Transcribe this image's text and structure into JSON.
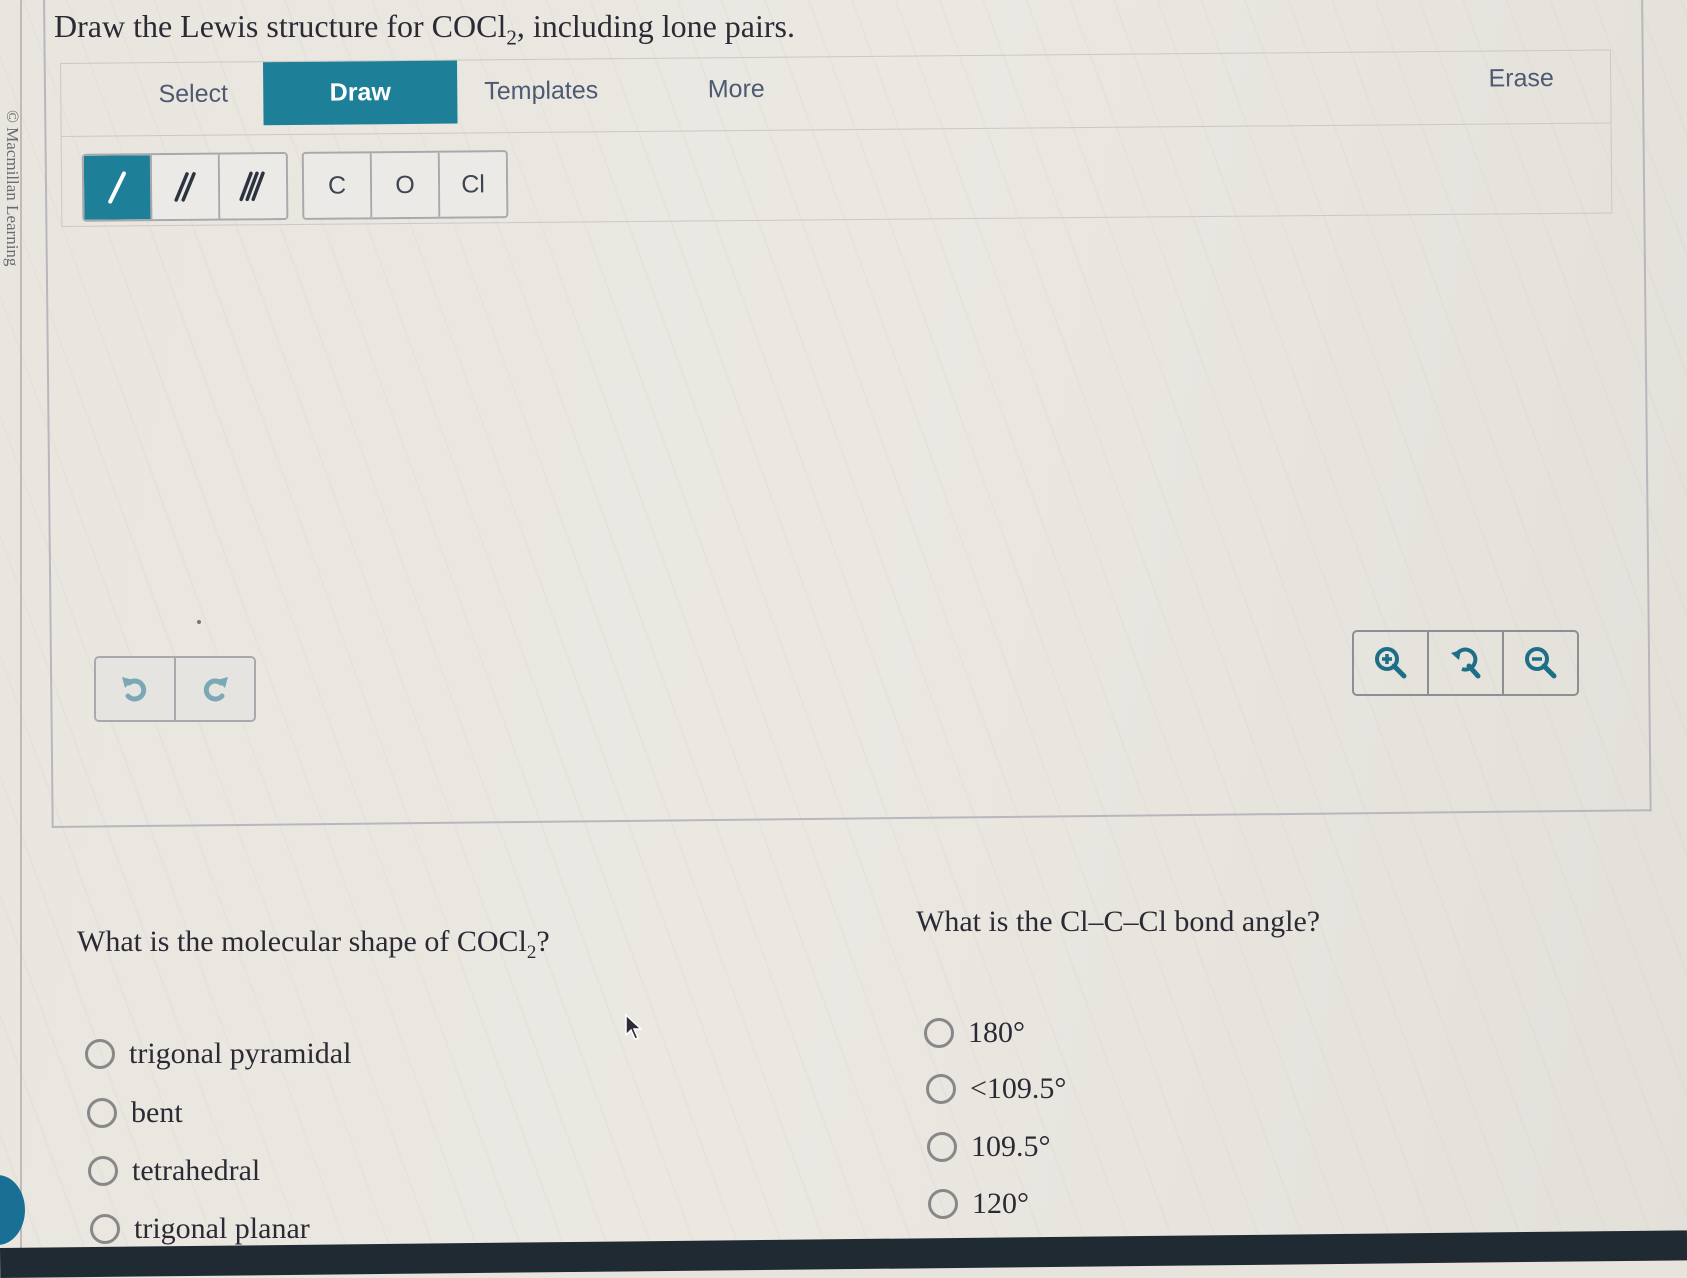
{
  "question_title": {
    "prefix": "Draw the Lewis structure for COCl",
    "subscript": "2",
    "suffix": ", including lone pairs."
  },
  "copyright": "© Macmillan Learning",
  "toolbar": {
    "tabs": [
      {
        "label": "Select",
        "active": false
      },
      {
        "label": "Draw",
        "active": true
      },
      {
        "label": "Templates",
        "active": false
      },
      {
        "label": "More",
        "active": false
      }
    ],
    "erase_label": "Erase",
    "bond_tools": [
      {
        "name": "single-bond",
        "glyph": "/",
        "active": true
      },
      {
        "name": "double-bond",
        "glyph": "//",
        "active": false
      },
      {
        "name": "triple-bond",
        "glyph": "///",
        "active": false
      }
    ],
    "atom_tools": [
      {
        "label": "C"
      },
      {
        "label": "O"
      },
      {
        "label": "Cl"
      }
    ]
  },
  "history_controls": [
    {
      "name": "undo",
      "icon": "undo-icon"
    },
    {
      "name": "redo",
      "icon": "redo-icon"
    }
  ],
  "zoom_controls": [
    {
      "name": "zoom-in",
      "icon": "zoom-in-icon"
    },
    {
      "name": "reset-zoom",
      "icon": "zoom-reset-icon"
    },
    {
      "name": "zoom-out",
      "icon": "zoom-out-icon"
    }
  ],
  "shape_question": {
    "prefix": "What is the molecular shape of COCl",
    "subscript": "2",
    "suffix": "?",
    "options": [
      "trigonal pyramidal",
      "bent",
      "tetrahedral",
      "trigonal planar"
    ],
    "selected": null
  },
  "angle_question": {
    "text": "What is the Cl–C–Cl bond angle?",
    "options": [
      "180°",
      "<109.5°",
      "109.5°",
      "120°"
    ],
    "selected": null
  },
  "colors": {
    "accent": "#1e7f98",
    "text": "#2e2a35",
    "tab_text": "#4d5a72",
    "icon_teal": "#1c6f86",
    "icon_disabled": "#7aa9b5"
  }
}
